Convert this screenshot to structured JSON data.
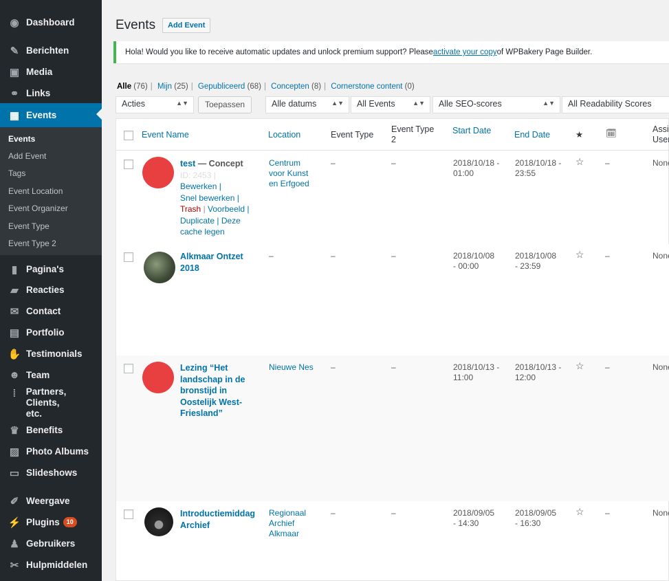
{
  "sidebar": {
    "items": [
      {
        "label": "Dashboard",
        "icon": "dashboard-icon",
        "glyph": "◉"
      },
      {
        "label": "Berichten",
        "icon": "pin-icon",
        "glyph": "✎"
      },
      {
        "label": "Media",
        "icon": "media-icon",
        "glyph": "▣"
      },
      {
        "label": "Links",
        "icon": "link-icon",
        "glyph": "⚭"
      },
      {
        "label": "Events",
        "icon": "calendar-icon",
        "glyph": "▦"
      },
      {
        "label": "Pagina's",
        "icon": "page-icon",
        "glyph": "▮"
      },
      {
        "label": "Reacties",
        "icon": "comment-icon",
        "glyph": "▰"
      },
      {
        "label": "Contact",
        "icon": "mail-icon",
        "glyph": "✉"
      },
      {
        "label": "Portfolio",
        "icon": "portfolio-icon",
        "glyph": "▤"
      },
      {
        "label": "Testimonials",
        "icon": "thumbs-up-icon",
        "glyph": "✋"
      },
      {
        "label": "Team",
        "icon": "team-icon",
        "glyph": "☻"
      },
      {
        "label": "Partners, Clients,",
        "label2": "etc.",
        "icon": "grid-icon",
        "glyph": "⁞"
      },
      {
        "label": "Benefits",
        "icon": "trophy-icon",
        "glyph": "♛"
      },
      {
        "label": "Photo Albums",
        "icon": "album-icon",
        "glyph": "▨"
      },
      {
        "label": "Slideshows",
        "icon": "slideshow-icon",
        "glyph": "▭"
      },
      {
        "label": "Weergave",
        "icon": "brush-icon",
        "glyph": "✐"
      },
      {
        "label": "Plugins",
        "icon": "plugin-icon",
        "glyph": "⚡",
        "badge": "10"
      },
      {
        "label": "Gebruikers",
        "icon": "user-icon",
        "glyph": "♟"
      },
      {
        "label": "Hulpmiddelen",
        "icon": "wrench-icon",
        "glyph": "✂"
      }
    ],
    "submenu": [
      "Events",
      "Add Event",
      "Tags",
      "Event Location",
      "Event Organizer",
      "Event Type",
      "Event Type 2"
    ]
  },
  "header": {
    "title": "Events",
    "add_button": "Add Event"
  },
  "notice": {
    "before": "Hola! Would you like to receive automatic updates and unlock premium support? Please ",
    "link": "activate your copy",
    "after": " of WPBakery Page Builder."
  },
  "views": [
    {
      "label": "Alle",
      "count": "(76)"
    },
    {
      "label": "Mijn",
      "count": "(25)"
    },
    {
      "label": "Gepubliceerd",
      "count": "(68)"
    },
    {
      "label": "Concepten",
      "count": "(8)"
    },
    {
      "label": "Cornerstone content",
      "count": "(0)"
    }
  ],
  "filters": {
    "bulk": "Acties",
    "apply": "Toepassen",
    "dates": "Alle datums",
    "events": "All Events",
    "seo": "Alle SEO-scores",
    "readability": "All Readability Scores"
  },
  "columns": {
    "name": "Event Name",
    "location": "Location",
    "type": "Event Type",
    "type2_a": "Event Type",
    "type2_b": "2",
    "start": "Start Date",
    "end": "End Date",
    "star_icon": "★",
    "cal_icon": "🗓",
    "assigned_a": "Assi",
    "assigned_b": "User"
  },
  "rows": [
    {
      "title": "test",
      "state": " — Concept",
      "id": "ID: 2453 |",
      "actions": [
        "Bewerken |",
        "Snel bewerken |",
        "Trash",
        " | ",
        "Voorbeeld |",
        "Duplicate | Deze cache legen"
      ],
      "loc": [
        "Centrum",
        "voor Kunst",
        "en Erfgoed"
      ],
      "type": "–",
      "type2": "–",
      "start": [
        "2018/10/18 -",
        "01:00"
      ],
      "end": [
        "2018/10/18 -",
        "23:55"
      ],
      "star": "☆",
      "cal": "–",
      "assigned": "None",
      "thumb_color": "#e84040"
    },
    {
      "title": "Alkmaar Ontzet",
      "title2": "2018",
      "loc": [
        "–"
      ],
      "type": "–",
      "type2": "–",
      "start": [
        "2018/10/08",
        "- 00:00"
      ],
      "end": [
        "2018/10/08",
        "- 23:59"
      ],
      "star": "☆",
      "cal": "–",
      "assigned": "None",
      "thumb_color": "#5d6a52"
    },
    {
      "title_lines": [
        "Lezing “Het",
        "landschap in de",
        "bronstijd in",
        "Oostelijk West-",
        "Friesland”"
      ],
      "loc": [
        "Nieuwe Nes"
      ],
      "type": "–",
      "type2": "–",
      "start": [
        "2018/10/13 -",
        "11:00"
      ],
      "end": [
        "2018/10/13 -",
        "12:00"
      ],
      "star": "☆",
      "cal": "–",
      "assigned": "None",
      "thumb_color": "#e84040"
    },
    {
      "title": "Introductiemiddag",
      "title2": "Archief",
      "loc": [
        "Regionaal",
        "Archief",
        "Alkmaar"
      ],
      "type": "–",
      "type2": "–",
      "start": [
        "2018/09/05",
        "- 14:30"
      ],
      "end": [
        "2018/09/05",
        "- 16:30"
      ],
      "star": "☆",
      "cal": "–",
      "assigned": "None",
      "thumb_color": "#2e2e2e"
    }
  ],
  "colors": {
    "sidebar": "#23282d",
    "submenu": "#32373c",
    "accent": "#0073aa",
    "notice": "#46b450"
  }
}
